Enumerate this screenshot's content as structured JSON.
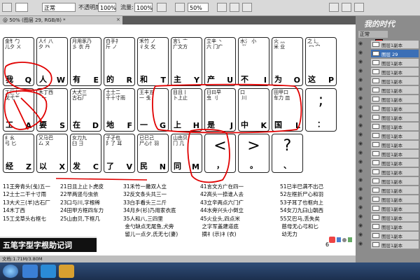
{
  "toolbar": {
    "style_value": "正常",
    "opacity_label": "不透明度:",
    "opacity_value": "100%",
    "flow_label": "流量:",
    "flow_value": "100%",
    "zoom_value": "50%"
  },
  "document_tab": {
    "title": "@ 50% (图层 29, RGB/8) *",
    "close": "×"
  },
  "keyboard": {
    "row1": [
      {
        "radicals": "金钅勹\n儿夕 ㄨ",
        "char": "我",
        "letter": "Q"
      },
      {
        "radicals": "人亻八\n夕 癶",
        "char": "人",
        "letter": "W"
      },
      {
        "radicals": "月用豕乃\n彡 衣 丹",
        "char": "有",
        "letter": "E"
      },
      {
        "radicals": "白手扌\n斤 ノ",
        "char": "的",
        "letter": "R"
      },
      {
        "radicals": "禾竹 ノ\n彳夂 攵",
        "char": "和",
        "letter": "T"
      },
      {
        "radicals": "言讠亠\n广文方",
        "char": "主",
        "letter": "Y"
      },
      {
        "radicals": "立辛 丶\n六 门疒",
        "char": "产",
        "letter": "U"
      },
      {
        "radicals": "水氵 小\n ⺌",
        "char": "不",
        "letter": "I"
      },
      {
        "radicals": "火 灬\n米 业",
        "char": "为",
        "letter": "O"
      },
      {
        "radicals": "之 辶\n 冖 宀",
        "char": "这",
        "letter": "P"
      }
    ],
    "row2": [
      {
        "radicals": "工匚七\n戈弋艹",
        "char": "工",
        "letter": "A"
      },
      {
        "radicals": "木丁西\n  ⼀",
        "char": "要",
        "letter": "S"
      },
      {
        "radicals": "大犬三\n古石厂",
        "char": "在",
        "letter": "D"
      },
      {
        "radicals": "土士二\n干十寸雨",
        "char": "地",
        "letter": "F"
      },
      {
        "radicals": "王丰五\n一 戋",
        "char": "一",
        "letter": "G"
      },
      {
        "radicals": "目且丨\n卜上止",
        "char": "上",
        "letter": "H"
      },
      {
        "radicals": "日曰早\n虫 刂",
        "char": "是",
        "letter": "J"
      },
      {
        "radicals": "口\n 川",
        "char": "中",
        "letter": "K"
      },
      {
        "radicals": "田甲口\n车力 皿",
        "char": "国",
        "letter": "L"
      },
      {
        "punct": ";",
        "sub": "："
      }
    ],
    "row3": [
      {
        "radicals": "纟幺\n弓 匕",
        "char": "经",
        "letter": "Z"
      },
      {
        "radicals": "又马巴\n厶 ㄡ",
        "char": "以",
        "letter": "X"
      },
      {
        "radicals": "女刀九\n臼 彐",
        "char": "发",
        "letter": "C"
      },
      {
        "radicals": "子孑也\n阝了 耳",
        "char": "了",
        "letter": "V"
      },
      {
        "radicals": "已巳己\n尸心忄羽",
        "char": "民",
        "letter": "N"
      },
      {
        "radicals": "山由贝\n冂 几",
        "char": "同",
        "letter": "M"
      },
      {
        "punct": "<",
        "sub": "，"
      },
      {
        "punct": ">",
        "sub": "。"
      },
      {
        "punct": "?",
        "sub": "、"
      }
    ]
  },
  "rhymes": [
    "11王旁青头(戋)五一\n12土士二干十寸雨\n13大犬三(羊)古石厂\n14木丁西\n15工戈草头右框七",
    "21日且上止卜虎皮\n22早两竖与虫依\n23口与川,字根稀\n24田甲方框四车力\n25山由贝,下框几",
    "31禾竹一撇双人立\n32反文条头共三一\n33白手看头三二斤\n34月乡(衫)乃用家衣底\n35人和八,三四里\n 金勺缺点无尾鱼,犬旁\n 留儿一点夕,氏无七(妻)",
    "41言文方广在四一\n42高头一捺谁人去\n43立辛两点六门疒\n44水旁兴头小倒立\n45火业头,四点米\n 之字军盖建道底\n 摘礻(示)衤(衣)",
    "51已半巳满不出己\n52左框折尸心和羽\n53子耳了也框向上\n54女刀九臼山朝西\n55又巴马,丢失矣\n 慈母无心弓和匕\n 幼无力"
  ],
  "footer_title": "五笔字型字根助记词",
  "page_number": "6",
  "status_bar": "文档:1.71M/3.80M",
  "watermark": "我的时代",
  "layers_panel": {
    "tab_label": "正常",
    "selected_layer": "图层 29",
    "layer_labels": [
      "图层1副本",
      "图层 29",
      "图层1副本",
      "图层1副本",
      "图层1副本",
      "图层1副本",
      "图层1副本",
      "图层1副本",
      "图层1副本",
      "图层1副本",
      "图层1副本",
      "图层1副本",
      "图层1副本",
      "图层1副本",
      "图层1副本",
      "图层1副本",
      "图层1副本",
      "图层1副本",
      "图层1副本",
      "图层1副本",
      "图层1副本",
      "图层1副本",
      "图层1副本"
    ]
  },
  "colors": {
    "annotation_red": "#e00000",
    "selected_layer": "#3b6fb6",
    "foreground_swatch": "#d80000"
  }
}
